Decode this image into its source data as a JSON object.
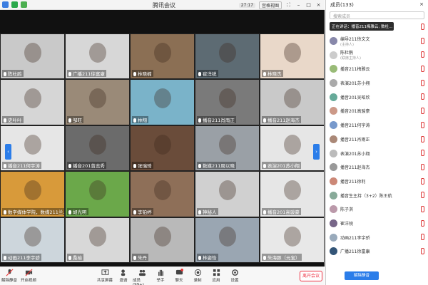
{
  "window": {
    "title": "腾讯会议",
    "time": "27:17",
    "view_label": "宫格视图"
  },
  "tiles": [
    {
      "name": "陈杜鹃",
      "bg": "#c9c9c9",
      "muted": true
    },
    {
      "name": "广播211徐富康",
      "bg": "#d7d7d7",
      "muted": true
    },
    {
      "name": "林晓楠",
      "bg": "#8b6f54",
      "muted": true
    },
    {
      "name": "崔洋锐",
      "bg": "#5d6b73",
      "muted": true
    },
    {
      "name": "林晓杰",
      "bg": "#e9d8c9",
      "muted": true
    },
    {
      "name": "史叶叶",
      "bg": "#d6d6d6",
      "muted": true
    },
    {
      "name": "邹旺",
      "bg": "#9a8a78",
      "muted": true
    },
    {
      "name": "林翔",
      "bg": "#7ab3c9",
      "muted": true
    },
    {
      "name": "播音211肖雨正",
      "bg": "#7a7a7a",
      "muted": true
    },
    {
      "name": "播音211赵海杰",
      "bg": "#c9c9c9",
      "muted": true
    },
    {
      "name": "播音211何宇涛",
      "bg": "#e6e6e6",
      "muted": true
    },
    {
      "name": "播音201曾志秀",
      "bg": "#6b6b6b",
      "muted": true
    },
    {
      "name": "张瑞琦",
      "bg": "#6a4c3a",
      "muted": true
    },
    {
      "name": "数媒211周以晓",
      "bg": "#9aa0a6",
      "muted": true
    },
    {
      "name": "表演201苏小翔",
      "bg": "#e6e6e6",
      "muted": true
    },
    {
      "name": "数字媒体学院，数媒211兰…",
      "bg": "#d89a3a",
      "muted": true
    },
    {
      "name": "胡光明",
      "bg": "#6ba84a",
      "muted": true
    },
    {
      "name": "李铂婷",
      "bg": "#8e6f58",
      "muted": true
    },
    {
      "name": "神秘人",
      "bg": "#d0d0d0",
      "muted": true
    },
    {
      "name": "播音201高骏豪",
      "bg": "#e6e6e6",
      "muted": true
    },
    {
      "name": "动画211李宇骄",
      "bg": "#cdd6dc",
      "muted": true
    },
    {
      "name": "桑榆",
      "bg": "#d8d8d8",
      "muted": true
    },
    {
      "name": "朱丹",
      "bg": "#b9b9b9",
      "muted": true
    },
    {
      "name": "林姿怡",
      "bg": "#9aa6b2",
      "muted": true
    },
    {
      "name": "朱海豚（元宝）",
      "bg": "#e8e8e8",
      "muted": true
    }
  ],
  "toolbar": {
    "unmute": "解除静音",
    "video": "开启视频",
    "share": "共享屏幕",
    "invite": "邀请",
    "members": "成员(99+)",
    "raise": "举手",
    "chat": "聊天",
    "record": "录制",
    "apps": "应用",
    "settings": "设置",
    "leave": "离开会议"
  },
  "panel": {
    "title": "成员(133)",
    "search_placeholder": "搜索成员",
    "speaking_tooltip": "正在讲话：播音211梅雅云; 数杜…",
    "mute_all": "解除静音"
  },
  "members": [
    {
      "name": "(主持人)",
      "sub": "",
      "color": "#ddd"
    },
    {
      "name": "编导211徐文文",
      "sub": "(主持人)",
      "color": "#88a"
    },
    {
      "name": "陈杜鹃",
      "sub": "(联席主持人)",
      "color": "#ccc"
    },
    {
      "name": "播音211梅雅云",
      "sub": "",
      "color": "#9b7"
    },
    {
      "name": "表演201苏小翔",
      "sub": "",
      "color": "#aaa"
    },
    {
      "name": "播音201吴昭欣",
      "sub": "",
      "color": "#6a9"
    },
    {
      "name": "播音201高骏豪",
      "sub": "",
      "color": "#c98"
    },
    {
      "name": "播音211何宇涛",
      "sub": "",
      "color": "#79c"
    },
    {
      "name": "播音211肖雨正",
      "sub": "",
      "color": "#a87"
    },
    {
      "name": "表演201苏小翔",
      "sub": "",
      "color": "#bbb"
    },
    {
      "name": "播音211赵海杰",
      "sub": "",
      "color": "#999"
    },
    {
      "name": "播音211徐利",
      "sub": "",
      "color": "#c87"
    },
    {
      "name": "播音生主持（3+2）陈王航",
      "sub": "",
      "color": "#8a9"
    },
    {
      "name": "陈子淇",
      "sub": "",
      "color": "#b9a"
    },
    {
      "name": "崔洋锐",
      "sub": "",
      "color": "#768"
    },
    {
      "name": "动画211李宇骄",
      "sub": "",
      "color": "#9ab"
    },
    {
      "name": "广播211徐富康",
      "sub": "",
      "color": "#357"
    }
  ]
}
